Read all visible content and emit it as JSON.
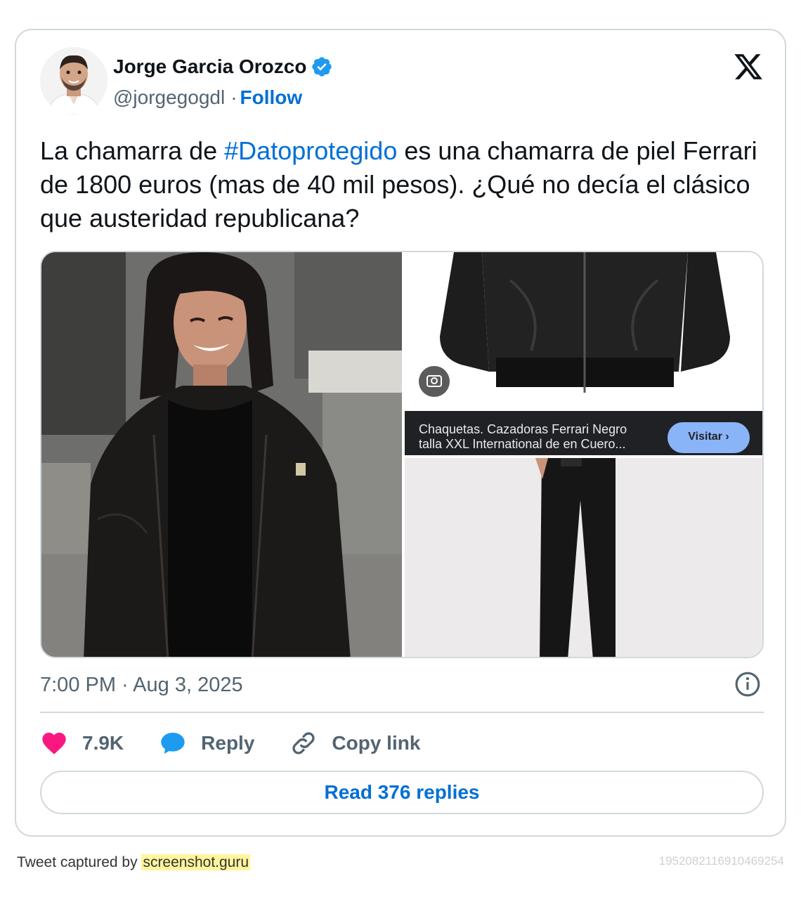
{
  "author": {
    "name": "Jorge Garcia Orozco",
    "handle": "@jorgegogdl",
    "separator": "·",
    "follow_label": "Follow",
    "verified_color": "#1d9bf0"
  },
  "tweet": {
    "text_before": "La chamarra de ",
    "hashtag": "#Datoprotegido",
    "text_after": " es una chamarra de piel Ferrari de 1800 euros (mas de 40 mil pesos). ¿Qué no decía el clásico que austeridad republicana?",
    "timestamp": "7:00 PM · Aug 3, 2025"
  },
  "media": {
    "ad_caption_line1": "Chaquetas. Cazadoras Ferrari Negro",
    "ad_caption_line2": "talla XXL International de en Cuero...",
    "ad_button_label": "Visitar"
  },
  "actions": {
    "likes": "7.9K",
    "reply_label": "Reply",
    "copy_label": "Copy link",
    "like_color": "#f91880",
    "reply_color": "#1d9bf0"
  },
  "read_replies_label": "Read 376 replies",
  "footer": {
    "prefix": "Tweet captured by ",
    "brand": "screenshot.guru",
    "tweet_id": "1952082116910469254"
  },
  "icons": {
    "platform": "x-logo-icon",
    "verified": "verified-badge-icon",
    "info": "info-icon",
    "like": "heart-icon",
    "reply": "speech-bubble-icon",
    "copy": "link-icon"
  }
}
